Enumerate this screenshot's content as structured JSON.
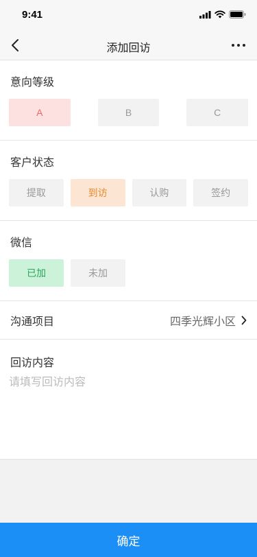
{
  "status_bar": {
    "time": "9:41"
  },
  "nav": {
    "title": "添加回访",
    "back_icon": "chevron-left-icon",
    "more_icon": "more-dots-icon"
  },
  "intent_level": {
    "title": "意向等级",
    "options": [
      "A",
      "B",
      "C"
    ],
    "selected": "A"
  },
  "customer_status": {
    "title": "客户状态",
    "options": [
      "提取",
      "到访",
      "认购",
      "签约"
    ],
    "selected": "到访"
  },
  "wechat": {
    "title": "微信",
    "options": [
      "已加",
      "未加"
    ],
    "selected": "已加"
  },
  "project": {
    "label": "沟通项目",
    "value": "四季光辉小区",
    "chevron_icon": "chevron-right-icon"
  },
  "visit_content": {
    "title": "回访内容",
    "placeholder": "请填写回访内容",
    "value": ""
  },
  "confirm_label": "确定",
  "colors": {
    "accent": "#1b8ff5",
    "selected_red_bg": "#fde1e1",
    "selected_orange_bg": "#fde5d3",
    "selected_green_bg": "#ccf2d9"
  }
}
